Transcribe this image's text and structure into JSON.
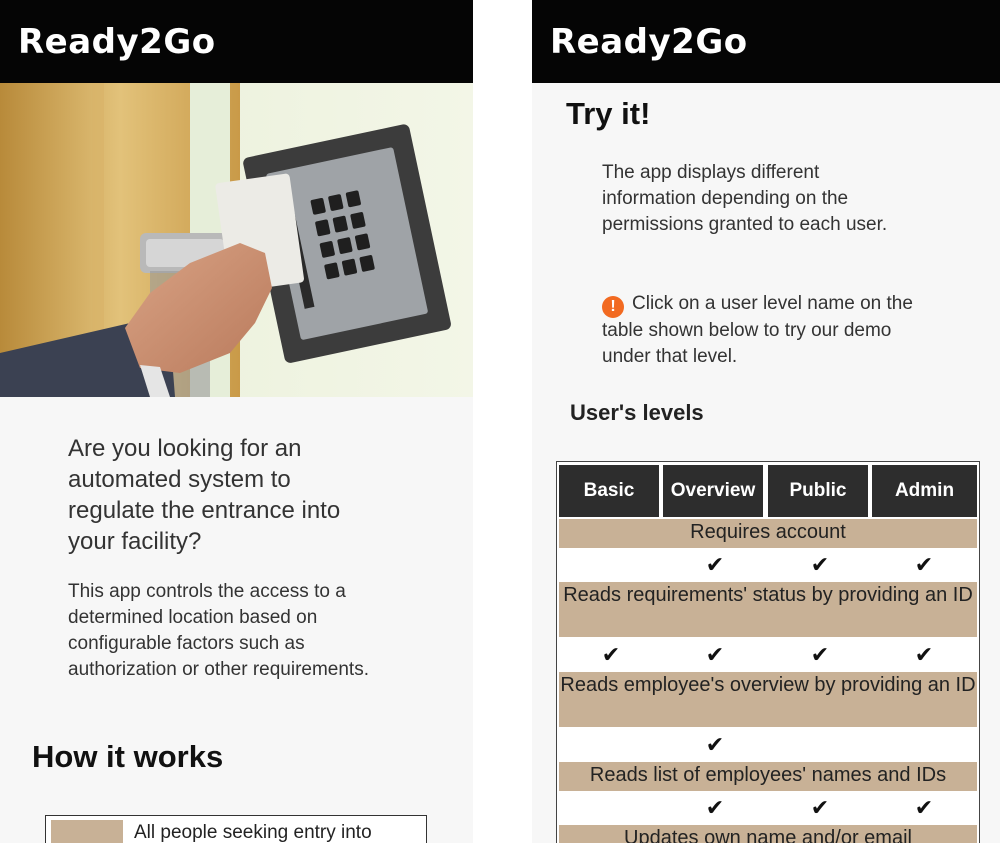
{
  "app": {
    "brand": "Ready2Go"
  },
  "left": {
    "lead": "Are you looking for an automated system to regulate the entrance into your facility?",
    "description": "This app controls the access to a determined location based on configurable factors such as authorization or other requirements.",
    "how_title": "How it works",
    "steps": [
      {
        "text": "All people seeking entry into",
        "swatch_color": "#c8b196"
      }
    ]
  },
  "right": {
    "title": "Try it!",
    "info": "The app displays different information depending on the permissions granted to each user.",
    "hint_icon": "exclamation-icon",
    "hint": "Click on a user level name on the table shown below to try our demo under that level.",
    "levels_title": "User's levels",
    "levels": [
      "Basic",
      "Overview",
      "Public",
      "Admin"
    ],
    "features": [
      {
        "label": "Requires account",
        "checks": [
          false,
          true,
          true,
          true
        ]
      },
      {
        "label": "Reads requirements' status by providing an ID",
        "checks": [
          true,
          true,
          true,
          true
        ]
      },
      {
        "label": "Reads employee's overview by providing an ID",
        "checks": [
          false,
          true,
          false,
          false
        ]
      },
      {
        "label": "Reads list of employees' names and IDs",
        "checks": [
          false,
          true,
          true,
          true
        ]
      },
      {
        "label": "Updates own name and/or email",
        "checks": []
      }
    ]
  },
  "colors": {
    "topbar": "#050505",
    "table_header": "#2d2d2d",
    "feature_band": "#c8b196",
    "warning": "#f26a21"
  },
  "check_glyph": "✔"
}
